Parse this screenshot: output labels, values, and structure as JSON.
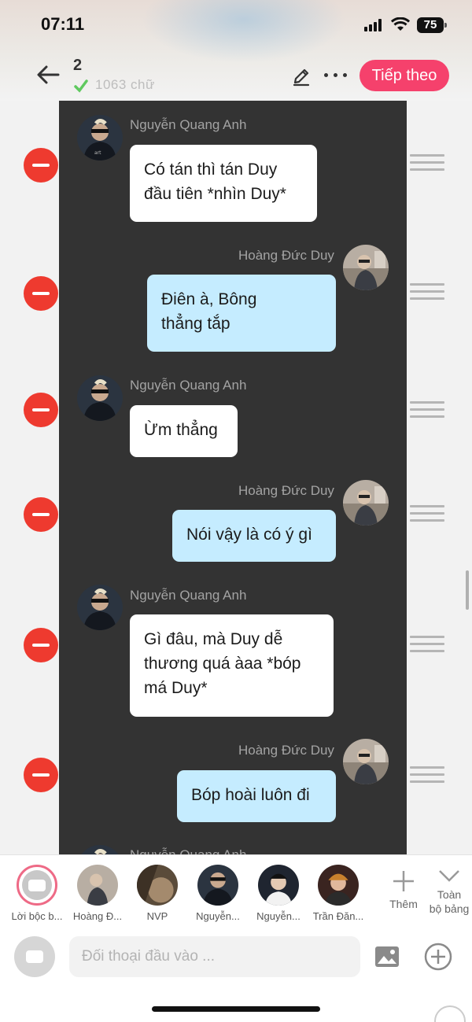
{
  "status": {
    "time": "07:11",
    "battery": "75"
  },
  "header": {
    "episode_number": "2",
    "word_count": "1063 chữ",
    "next_label": "Tiếp theo"
  },
  "messages": [
    {
      "speaker": "Nguyễn Quang Anh",
      "side": "left",
      "lines": [
        "Có tán thì tán Duy",
        "đầu tiên *nhìn Duy*"
      ]
    },
    {
      "speaker": "Hoàng Đức Duy",
      "side": "right",
      "lines": [
        "Điên à, Bông",
        "thẳng tắp"
      ]
    },
    {
      "speaker": "Nguyễn Quang Anh",
      "side": "left",
      "lines": [
        "Ừm thẳng"
      ]
    },
    {
      "speaker": "Hoàng Đức Duy",
      "side": "right",
      "lines": [
        "Nói vậy là có ý gì"
      ]
    },
    {
      "speaker": "Nguyễn Quang Anh",
      "side": "left",
      "lines": [
        "Gì đâu, mà Duy dễ",
        "thương quá àaa *bóp",
        "má Duy*"
      ]
    },
    {
      "speaker": "Hoàng Đức Duy",
      "side": "right",
      "lines": [
        "Bóp hoài luôn đi"
      ]
    },
    {
      "speaker": "Nguyễn Quang Anh",
      "side": "left",
      "lines": []
    }
  ],
  "characters": [
    {
      "label": "Lời bộc b...",
      "icon": "narration-icon"
    },
    {
      "label": "Hoàng Đ..."
    },
    {
      "label": "NVP"
    },
    {
      "label": "Nguyễn..."
    },
    {
      "label": "Nguyễn..."
    },
    {
      "label": "Trần Đăn..."
    }
  ],
  "char_actions": {
    "add_label": "Thêm",
    "all_label_1": "Toàn",
    "all_label_2": "bộ bảng"
  },
  "composer": {
    "placeholder": "Đối thoại đầu vào ..."
  },
  "colors": {
    "accent": "#f5416c",
    "delete": "#ee3a2f",
    "bubble_right": "#c5ecff",
    "story_bg": "#333333"
  }
}
